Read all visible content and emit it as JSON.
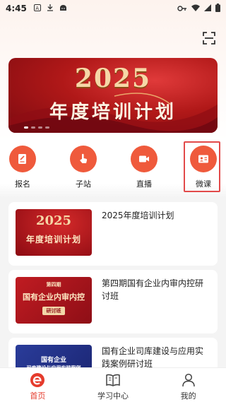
{
  "status_bar": {
    "time": "4:45",
    "icons": [
      "a-badge-icon",
      "download-icon",
      "android-icon",
      "key-icon",
      "wifi-icon",
      "signal-icon",
      "battery-icon"
    ]
  },
  "header": {
    "scan_icon": "scan-icon"
  },
  "banner": {
    "year": "2025",
    "title": "年度培训计划",
    "page_count": 4,
    "active_page": 1
  },
  "quick_nav": [
    {
      "label": "报名",
      "icon": "form-icon"
    },
    {
      "label": "子站",
      "icon": "pointer-hand-icon"
    },
    {
      "label": "直播",
      "icon": "video-camera-icon"
    },
    {
      "label": "微课",
      "icon": "id-card-icon"
    }
  ],
  "courses": [
    {
      "title": "2025年度培训计划",
      "thumb_line1": "2025",
      "thumb_line2": "年度培训计划"
    },
    {
      "title": "第四期国有企业内审内控研讨班",
      "thumb_line1": "第四期",
      "thumb_line2": "国有企业内审内控",
      "thumb_line3": "研讨班"
    },
    {
      "title": "国有企业司库建设与应用实践案例研讨班",
      "thumb_line1": "国有企业",
      "thumb_line2": "司库建设与应用实践案例"
    }
  ],
  "tab_bar": [
    {
      "label": "首页",
      "icon": "home-e-icon",
      "active": true
    },
    {
      "label": "学习中心",
      "icon": "book-icon",
      "active": false
    },
    {
      "label": "我的",
      "icon": "person-icon",
      "active": false
    }
  ],
  "colors": {
    "accent": "#e53b2c",
    "icon_bg": "#ef5a3c",
    "banner_red": "#b01818"
  }
}
